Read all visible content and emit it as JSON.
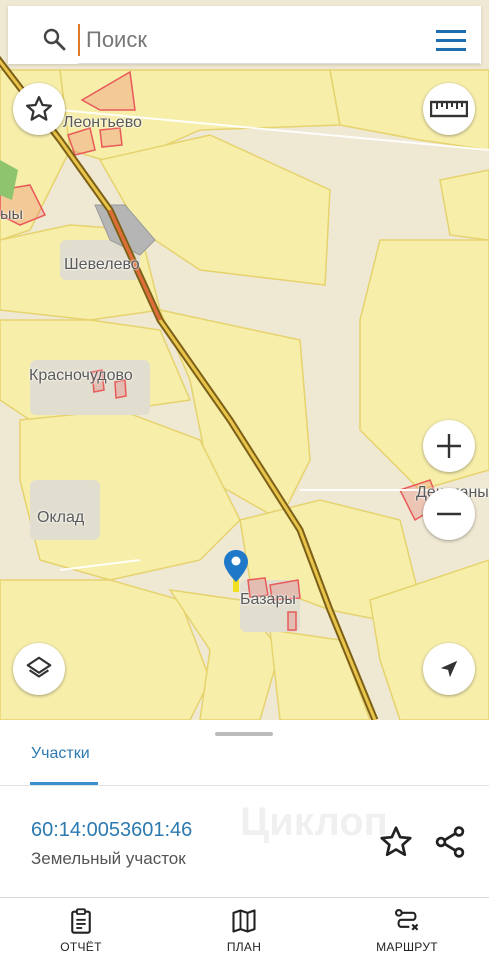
{
  "search": {
    "placeholder": "Поиск"
  },
  "map": {
    "labels": {
      "leontyevo": "Леонтьево",
      "shevelevo": "Шевелево",
      "krasnoe_chudovo": "Красночудово",
      "oklad": "Оклад",
      "bazary": "Базары",
      "deshmany": "Дешманы",
      "edge_label": "ыы"
    }
  },
  "sheet": {
    "tab_label": "Участки",
    "parcel_id": "60:14:0053601:46",
    "parcel_type": "Земельный участок",
    "watermark": "Циклоп"
  },
  "nav": {
    "report": "ОТЧЁТ",
    "plan": "ПЛАН",
    "route": "МАРШРУТ"
  },
  "colors": {
    "accent": "#2c7ab0",
    "map_background": "#efe8d2",
    "parcel_fill": "#f7eeaa",
    "parcel_border": "#e6d36e",
    "road": "#8a6d1f",
    "settlement": "#e85a5a",
    "marker": "#1f78c8"
  }
}
